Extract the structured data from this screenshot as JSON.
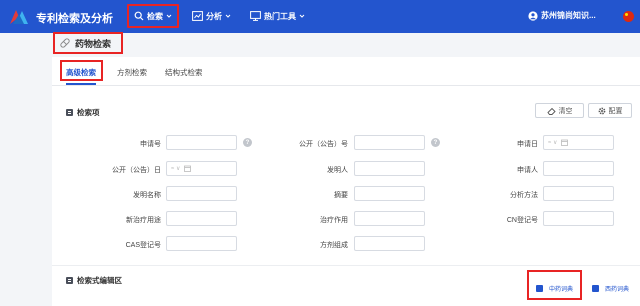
{
  "app": {
    "title": "专利检索及分析",
    "user": "苏州锦尚知识..."
  },
  "nav": {
    "search": "检索",
    "analysis": "分析",
    "hot_tools": "热门工具"
  },
  "page": {
    "title": "药物检索"
  },
  "tabs": [
    "高级检索",
    "方剂检索",
    "结构式检索"
  ],
  "search_section": {
    "title": "检索项",
    "clear_button": "清空",
    "config_button": "配置",
    "fields": {
      "app_no": "申请号",
      "pub_no": "公开（公告）号",
      "app_date": "申请日",
      "pub_date": "公开（公告）日",
      "inventor": "发明人",
      "applicant": "申请人",
      "inv_name": "发明名称",
      "abstract": "摘要",
      "analysis_method": "分析方法",
      "new_use": "新治疗用途",
      "treat_effect": "治疗作用",
      "cn_reg": "CN登记号",
      "cas_reg": "CAS登记号",
      "formula": "方剂组成"
    },
    "date_placeholder": "≈ ∨"
  },
  "editor_section": {
    "title": "检索式编辑区",
    "cn_dict": "中药词典",
    "west_dict": "西药词典"
  },
  "colors": {
    "brand": "#2355ce",
    "highlight": "#e82424"
  }
}
